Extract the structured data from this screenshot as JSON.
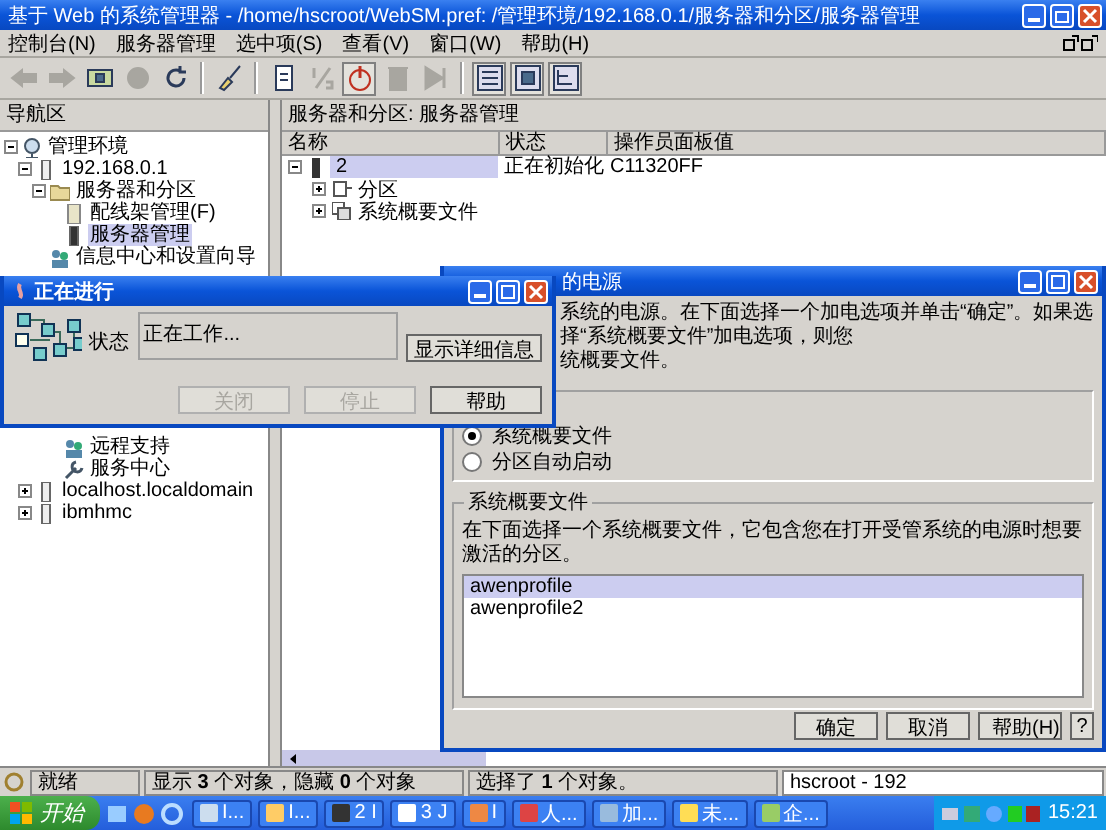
{
  "window": {
    "title": "基于 Web 的系统管理器 - /home/hscroot/WebSM.pref: /管理环境/192.168.0.1/服务器和分区/服务器管理"
  },
  "menu": [
    "控制台(N)",
    "服务器管理",
    "选中项(S)",
    "查看(V)",
    "窗口(W)",
    "帮助(H)"
  ],
  "toolbar": [
    {
      "kind": "back",
      "disabled": true
    },
    {
      "kind": "forward",
      "disabled": true
    },
    {
      "kind": "screen",
      "disabled": false
    },
    {
      "kind": "stop",
      "disabled": true
    },
    {
      "kind": "refresh",
      "disabled": false
    },
    {
      "kind": "sweep",
      "disabled": false
    },
    {
      "kind": "doc",
      "disabled": false
    },
    {
      "kind": "fraction",
      "disabled": true
    },
    {
      "kind": "power",
      "disabled": false
    },
    {
      "kind": "trash",
      "disabled": true
    },
    {
      "kind": "skip",
      "disabled": true
    },
    {
      "kind": "view-list",
      "disabled": false
    },
    {
      "kind": "view-icons",
      "disabled": false
    },
    {
      "kind": "view-tree",
      "disabled": false
    }
  ],
  "navigation": {
    "title": "导航区",
    "tree": [
      {
        "label": "管理环境",
        "kind": "environment",
        "expanded": true,
        "selected": false,
        "children": [
          {
            "label": "192.168.0.1",
            "kind": "host",
            "expanded": true,
            "selected": false,
            "children": [
              {
                "label": "服务器和分区",
                "kind": "folder",
                "expanded": true,
                "selected": false,
                "children": [
                  {
                    "label": "配线架管理(F)",
                    "kind": "frame",
                    "selected": false
                  },
                  {
                    "label": "服务器管理",
                    "kind": "server",
                    "selected": true
                  }
                ]
              },
              {
                "label": "信息中心和设置向导",
                "kind": "wizard",
                "selected": false,
                "children": [
                  {
                    "label": "远程支持",
                    "kind": "remote",
                    "selected": false
                  },
                  {
                    "label": "服务中心",
                    "kind": "service",
                    "selected": false
                  }
                ]
              }
            ]
          },
          {
            "label": "localhost.localdomain",
            "kind": "host",
            "expanded": false,
            "selected": false
          },
          {
            "label": "ibmhmc",
            "kind": "host",
            "expanded": false,
            "selected": false
          }
        ]
      }
    ]
  },
  "content": {
    "title": "服务器和分区: 服务器管理",
    "columns": [
      "名称",
      "状态",
      "操作员面板值"
    ],
    "rows": [
      {
        "name": "2",
        "status": "正在初始化",
        "panel": "C11320FF",
        "selected": true,
        "expanded": true,
        "children": [
          {
            "name": "分区",
            "kind": "partition",
            "expanded": false
          },
          {
            "name": "系统概要文件",
            "kind": "profiles",
            "expanded": false
          }
        ]
      }
    ]
  },
  "status_bar": [
    "就绪",
    "显示 **3** 个对象，隐藏 **0** 个对象",
    "选择了 **1** 个对象。",
    "hscroot - 192"
  ],
  "power_dialog": {
    "title": "的电源",
    "instructions": "系统的电源。在下面选择一个加电选项并单击“确定”。如果选择“系统概要文件”加电选项，则您",
    "instructions_2": "统概要文件。",
    "options": [
      {
        "label": "系统概要文件",
        "selected": true
      },
      {
        "label": "分区自动启动",
        "selected": false
      }
    ],
    "profile_group": {
      "title": "系统概要文件",
      "description": "在下面选择一个系统概要文件，它包含您在打开受管系统的电源时想要激活的分区。",
      "profiles": [
        {
          "name": "awenprofile",
          "selected": true
        },
        {
          "name": "awenprofile2",
          "selected": false
        }
      ]
    },
    "buttons": [
      "确定",
      "取消",
      "帮助(H)",
      "?"
    ]
  },
  "progress_dialog": {
    "title": "正在进行",
    "status_label": "状态",
    "status": "正在工作...",
    "details_button": "显示详细信息",
    "buttons": [
      {
        "label": "关闭",
        "disabled": true
      },
      {
        "label": "停止",
        "disabled": true
      },
      {
        "label": "帮助",
        "disabled": false
      }
    ]
  },
  "taskbar": {
    "start": "开始",
    "tasks": [
      "I...",
      "I...",
      "2 I",
      "3 J",
      "I",
      "人...",
      "加...",
      "未...",
      "企..."
    ],
    "clock": "15:21"
  }
}
